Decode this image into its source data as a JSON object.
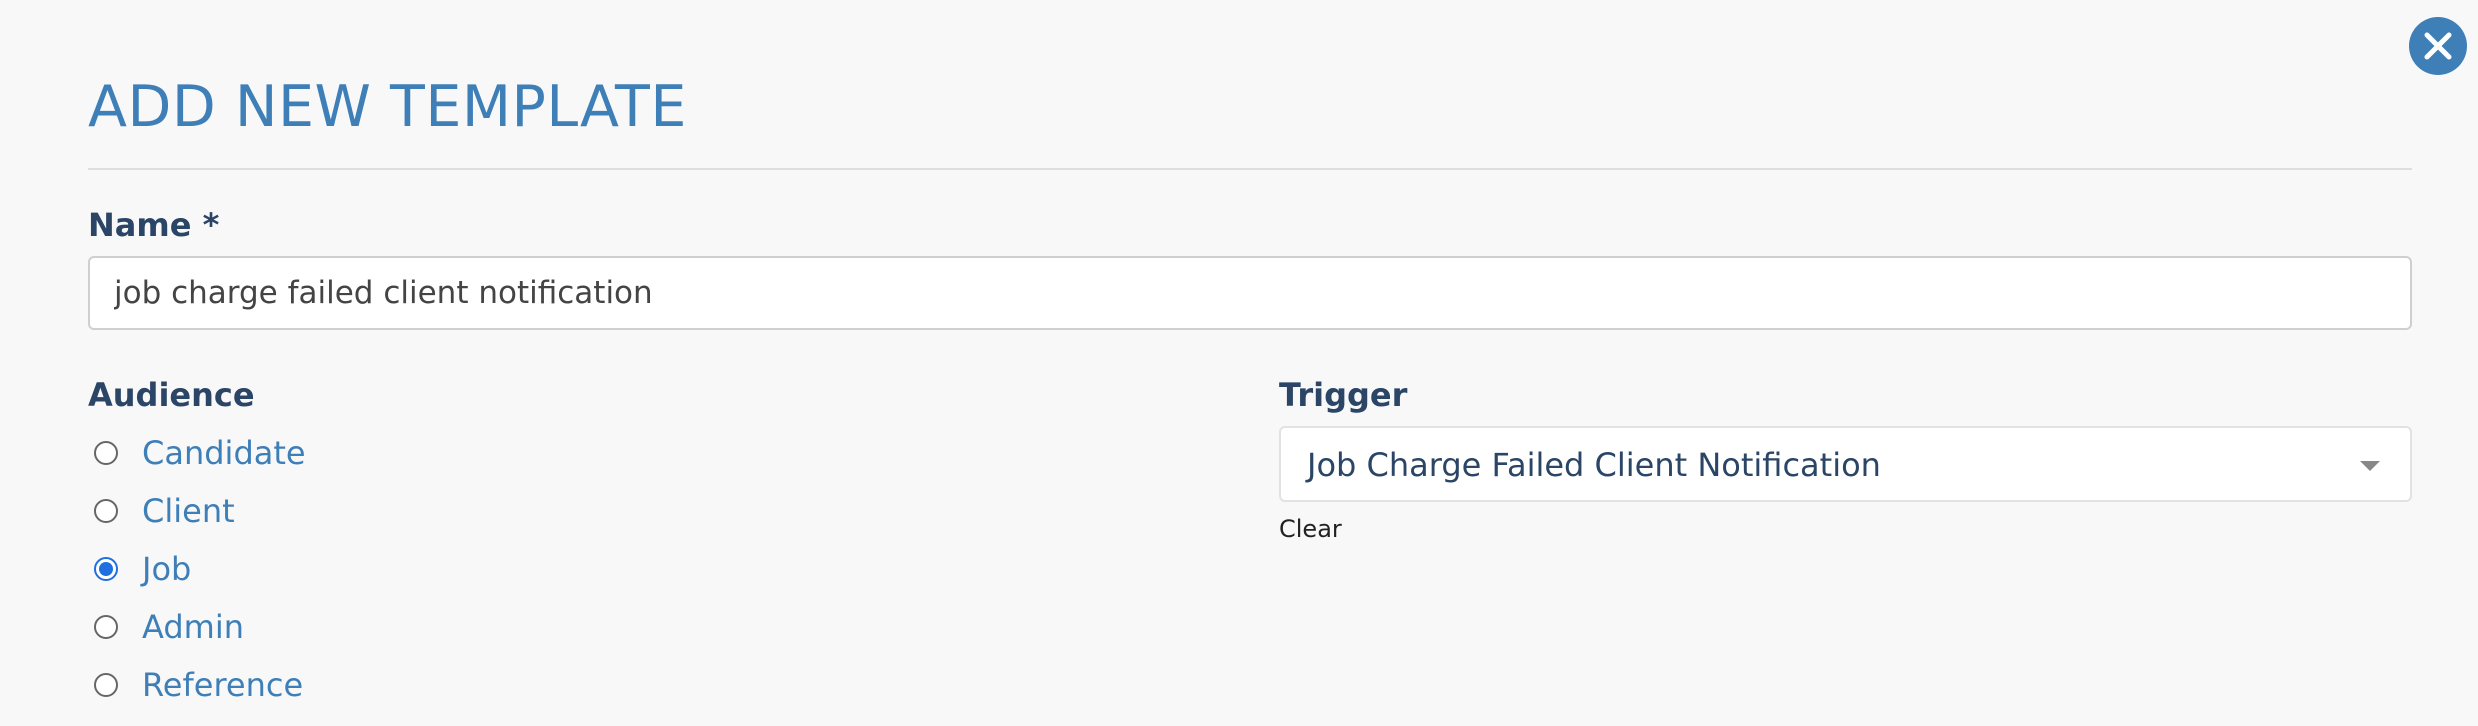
{
  "modal": {
    "title": "ADD NEW TEMPLATE",
    "accent_color": "#3f7fb8"
  },
  "name_field": {
    "label": "Name *",
    "value": "job charge failed client notification"
  },
  "audience": {
    "label": "Audience",
    "options": [
      {
        "label": "Candidate",
        "checked": false
      },
      {
        "label": "Client",
        "checked": false
      },
      {
        "label": "Job",
        "checked": true
      },
      {
        "label": "Admin",
        "checked": false
      },
      {
        "label": "Reference",
        "checked": false
      }
    ]
  },
  "trigger": {
    "label": "Trigger",
    "selected": "Job Charge Failed Client Notification",
    "clear_label": "Clear"
  },
  "icons": {
    "close": "close-icon",
    "dropdown": "chevron-down-icon"
  }
}
